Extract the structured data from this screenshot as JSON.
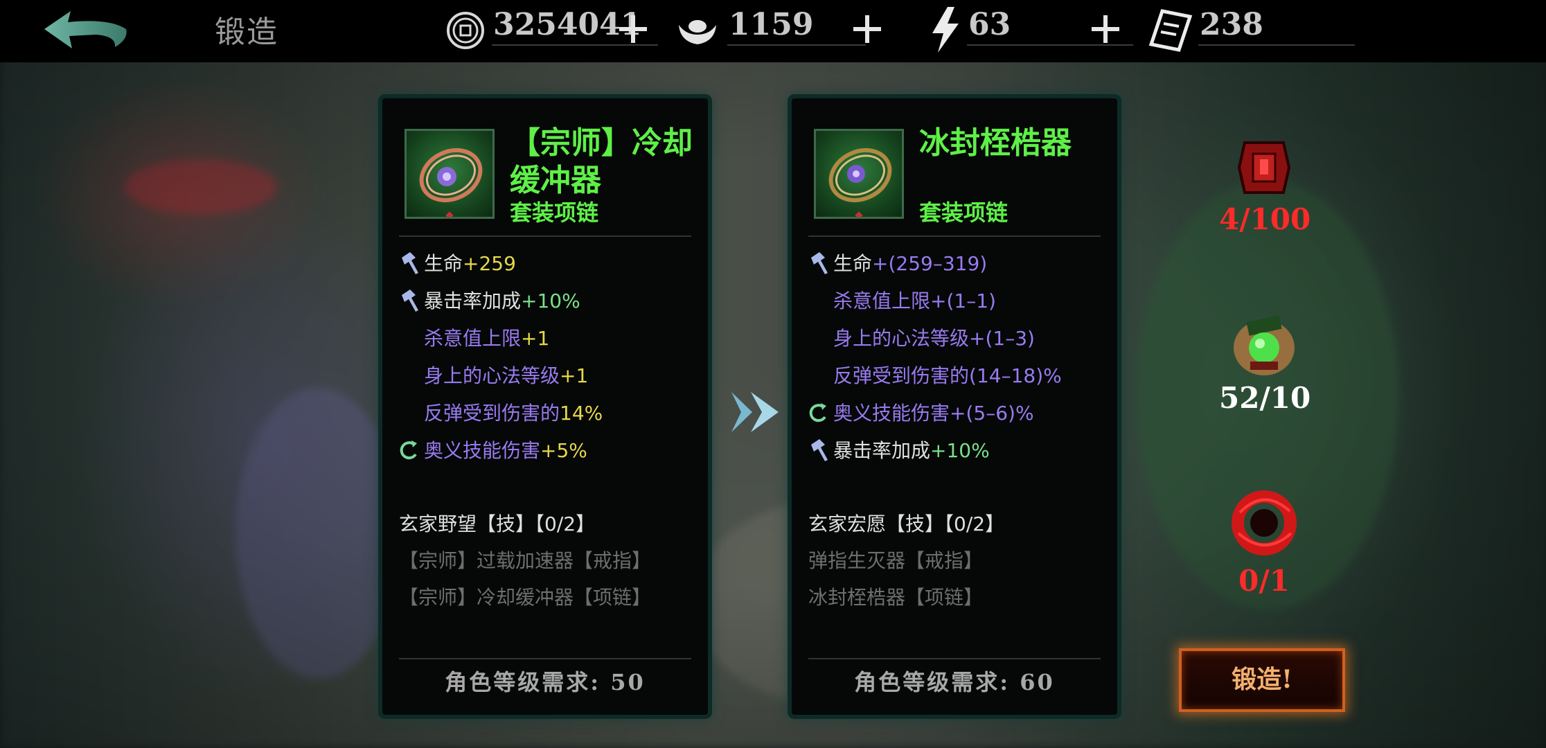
{
  "header": {
    "title": "锻造",
    "resources": [
      {
        "name": "copper-coin",
        "value": "3254041"
      },
      {
        "name": "silver-ingot",
        "value": "1159"
      },
      {
        "name": "energy",
        "value": "63"
      },
      {
        "name": "ticket",
        "value": "238"
      }
    ]
  },
  "left_item": {
    "name_line1": "【宗师】冷却",
    "name_line2": "缓冲器",
    "type": "套装项链",
    "stats": [
      {
        "label": "生命",
        "value": "+259"
      },
      {
        "label": "暴击率加成",
        "value": "+10%"
      },
      {
        "label": "杀意值上限",
        "value": "+1"
      },
      {
        "label": "身上的心法等级",
        "value": "+1"
      },
      {
        "label": "反弹受到伤害的",
        "value": "14%"
      },
      {
        "label": "奥义技能伤害",
        "value": "+5%"
      }
    ],
    "set_name": "玄家野望【技】【0/2】",
    "set_items": [
      "【宗师】过载加速器【戒指】",
      "【宗师】冷却缓冲器【项链】"
    ],
    "requirement": "角色等级需求: 50"
  },
  "right_item": {
    "name": "冰封桎梏器",
    "type": "套装项链",
    "stats": [
      {
        "label": "生命",
        "value": "+(259–319)"
      },
      {
        "label": "杀意值上限",
        "value": "+(1–1)"
      },
      {
        "label": "身上的心法等级",
        "value": "+(1–3)"
      },
      {
        "label": "反弹受到伤害的",
        "value": "(14–18)%"
      },
      {
        "label": "奥义技能伤害",
        "value": "+(5–6)%"
      },
      {
        "label": "暴击率加成",
        "value": "+10%"
      }
    ],
    "set_name": "玄家宏愿【技】【0/2】",
    "set_items": [
      "弹指生灭器【戒指】",
      "冰封桎梏器【项链】"
    ],
    "requirement": "角色等级需求: 60"
  },
  "materials": [
    {
      "name": "red-box-material",
      "count": "4/100",
      "color": "#ff2a2a"
    },
    {
      "name": "green-gem-material",
      "count": "52/10",
      "color": "#ffffff"
    },
    {
      "name": "red-ring-material",
      "count": "0/1",
      "color": "#ff2a2a"
    }
  ],
  "forge_button": "锻造!",
  "colors": {
    "item_name": "#5ff048",
    "stat_purple": "#9a7af0",
    "stat_yellow": "#e6d84a",
    "stat_green": "#7ae08a"
  }
}
